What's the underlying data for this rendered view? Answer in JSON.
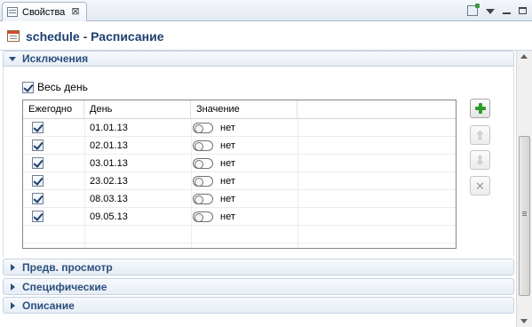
{
  "tab": {
    "title": "Свойства",
    "close_glyph": "⊠"
  },
  "form": {
    "title": "schedule - Расписание"
  },
  "exceptions": {
    "title": "Исключения",
    "all_day_label": "Весь день",
    "all_day_checked": true,
    "columns": [
      "Ежегодно",
      "День",
      "Значение"
    ],
    "rows": [
      {
        "yearly": true,
        "day": "01.01.13",
        "value": "нет"
      },
      {
        "yearly": true,
        "day": "02.01.13",
        "value": "нет"
      },
      {
        "yearly": true,
        "day": "03.01.13",
        "value": "нет"
      },
      {
        "yearly": true,
        "day": "23.02.13",
        "value": "нет"
      },
      {
        "yearly": true,
        "day": "08.03.13",
        "value": "нет"
      },
      {
        "yearly": true,
        "day": "09.05.13",
        "value": "нет"
      }
    ],
    "buttons": {
      "add_icon": "plus-icon",
      "up_glyph": "⇧",
      "down_glyph": "⇩",
      "delete_glyph": "✕"
    }
  },
  "sections": [
    {
      "title": "Предв. просмотр"
    },
    {
      "title": "Специфические"
    },
    {
      "title": "Описание"
    }
  ],
  "colors": {
    "accent": "#2b4f7c",
    "title": "#1f3f6f",
    "add_green": "#2f9a2a"
  }
}
